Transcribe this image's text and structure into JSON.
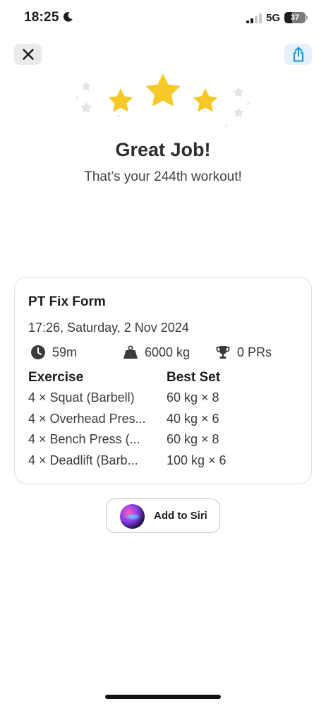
{
  "status_bar": {
    "time": "18:25",
    "network": "5G",
    "battery": "37",
    "battery_level": 0.37
  },
  "header": {
    "close_icon": "close-icon",
    "share_icon": "share-icon"
  },
  "celebration": {
    "rating_stars": 3,
    "star_color": "#f7c928",
    "title": "Great Job!",
    "subtitle": "That’s your 244th workout!"
  },
  "workout": {
    "name": "PT Fix Form",
    "datetime": "17:26, Saturday, 2 Nov 2024",
    "duration": "59m",
    "volume": "6000 kg",
    "prs": "0 PRs",
    "columns": {
      "exercise": "Exercise",
      "best_set": "Best Set"
    },
    "rows": [
      {
        "exercise": "4 × Squat (Barbell)",
        "best_set": "60 kg × 8"
      },
      {
        "exercise": "4 × Overhead Pres...",
        "best_set": "40 kg × 6"
      },
      {
        "exercise": "4 × Bench Press (...",
        "best_set": "60 kg × 8"
      },
      {
        "exercise": "4 × Deadlift (Barb...",
        "best_set": "100 kg × 6"
      }
    ]
  },
  "siri": {
    "label": "Add to Siri"
  },
  "colors": {
    "accent": "#1a8cd8",
    "star": "#f7c928",
    "text": "#1c1c1e"
  }
}
